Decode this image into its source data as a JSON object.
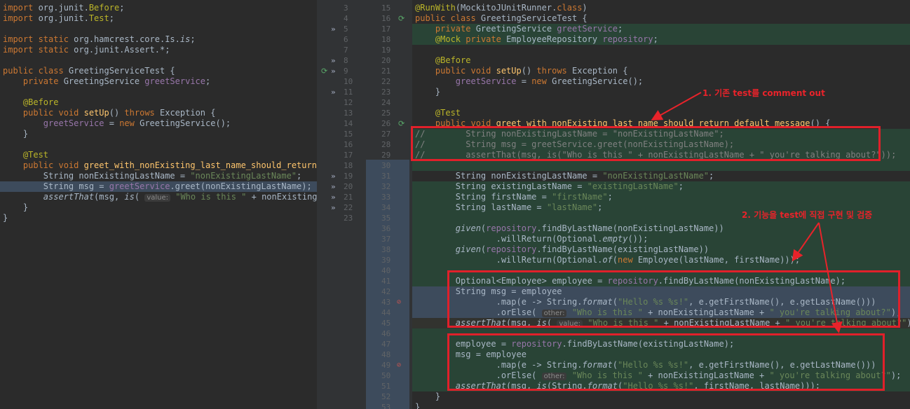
{
  "left": {
    "lines": [
      {
        "segs": [
          {
            "c": "kw",
            "t": "import "
          },
          {
            "t": "org.junit."
          },
          {
            "c": "ann",
            "t": "Before"
          },
          {
            "t": ";"
          }
        ]
      },
      {
        "segs": [
          {
            "c": "kw",
            "t": "import "
          },
          {
            "t": "org.junit."
          },
          {
            "c": "ann",
            "t": "Test"
          },
          {
            "t": ";"
          }
        ]
      },
      {
        "segs": []
      },
      {
        "segs": [
          {
            "c": "kw",
            "t": "import static "
          },
          {
            "t": "org.hamcrest.core.Is."
          },
          {
            "c": "it",
            "t": "is"
          },
          {
            "t": ";"
          }
        ]
      },
      {
        "segs": [
          {
            "c": "kw",
            "t": "import static "
          },
          {
            "t": "org.junit.Assert.*;"
          }
        ]
      },
      {
        "segs": []
      },
      {
        "segs": [
          {
            "c": "kw",
            "t": "public class "
          },
          {
            "t": "GreetingServiceTest {"
          }
        ]
      },
      {
        "segs": [
          {
            "t": "    "
          },
          {
            "c": "kw",
            "t": "private "
          },
          {
            "t": "GreetingService "
          },
          {
            "c": "fld",
            "t": "greetService"
          },
          {
            "t": ";"
          }
        ]
      },
      {
        "segs": []
      },
      {
        "segs": [
          {
            "t": "    "
          },
          {
            "c": "ann",
            "t": "@Before"
          }
        ]
      },
      {
        "segs": [
          {
            "t": "    "
          },
          {
            "c": "kw",
            "t": "public void "
          },
          {
            "c": "fn",
            "t": "setUp"
          },
          {
            "t": "() "
          },
          {
            "c": "kw",
            "t": "throws "
          },
          {
            "t": "Exception {"
          }
        ]
      },
      {
        "segs": [
          {
            "t": "        "
          },
          {
            "c": "fld",
            "t": "greetService"
          },
          {
            "t": " = "
          },
          {
            "c": "kw",
            "t": "new "
          },
          {
            "t": "GreetingService();"
          }
        ]
      },
      {
        "segs": [
          {
            "t": "    }"
          }
        ]
      },
      {
        "segs": []
      },
      {
        "segs": [
          {
            "t": "    "
          },
          {
            "c": "ann",
            "t": "@Test"
          }
        ]
      },
      {
        "segs": [
          {
            "t": "    "
          },
          {
            "c": "kw",
            "t": "public void "
          },
          {
            "c": "fn",
            "t": "greet_with_nonExisting_last_name_should_return_d"
          }
        ]
      },
      {
        "segs": [
          {
            "t": "        String nonExistingLastName = "
          },
          {
            "c": "str",
            "t": "\"nonExistingLastName\""
          },
          {
            "t": ";"
          }
        ]
      },
      {
        "hl": "blue",
        "segs": [
          {
            "t": "        String msg = "
          },
          {
            "c": "fld",
            "t": "greetService"
          },
          {
            "t": ".greet(nonExistingLastName);"
          }
        ]
      },
      {
        "segs": [
          {
            "t": "        "
          },
          {
            "c": "it",
            "t": "assertThat"
          },
          {
            "t": "(msg, "
          },
          {
            "c": "it",
            "t": "is"
          },
          {
            "t": "( "
          },
          {
            "c": "hint",
            "t": "value:"
          },
          {
            "t": " "
          },
          {
            "c": "str",
            "t": "\"Who is this \""
          },
          {
            "t": " + nonExistingLas"
          }
        ]
      },
      {
        "segs": [
          {
            "t": "    }"
          }
        ]
      },
      {
        "segs": [
          {
            "t": "}"
          }
        ]
      }
    ]
  },
  "left_gutter": [
    {
      "n": "3"
    },
    {
      "n": "4"
    },
    {
      "n": "5",
      "m": "»"
    },
    {
      "n": "6"
    },
    {
      "n": "7"
    },
    {
      "n": "8",
      "m": "»"
    },
    {
      "n": "9",
      "m": "»",
      "run": true
    },
    {
      "n": "10"
    },
    {
      "n": "11",
      "m": "»"
    },
    {
      "n": "12"
    },
    {
      "n": "13"
    },
    {
      "n": "14"
    },
    {
      "n": "15"
    },
    {
      "n": "16"
    },
    {
      "n": "17"
    },
    {
      "n": "18"
    },
    {
      "n": "19",
      "m": "»"
    },
    {
      "n": "20",
      "m": "»"
    },
    {
      "n": "21",
      "m": "»"
    },
    {
      "n": "22",
      "m": "»"
    },
    {
      "n": "23"
    }
  ],
  "right_gutter": [
    {
      "n": "15"
    },
    {
      "n": "16",
      "run": true
    },
    {
      "n": "17"
    },
    {
      "n": "18"
    },
    {
      "n": "19"
    },
    {
      "n": "20"
    },
    {
      "n": "21"
    },
    {
      "n": "22"
    },
    {
      "n": "23"
    },
    {
      "n": "24"
    },
    {
      "n": "25"
    },
    {
      "n": "26",
      "run": true
    },
    {
      "n": "27"
    },
    {
      "n": "28"
    },
    {
      "n": "29"
    },
    {
      "n": "30"
    },
    {
      "n": "31"
    },
    {
      "n": "32"
    },
    {
      "n": "33"
    },
    {
      "n": "34"
    },
    {
      "n": "35"
    },
    {
      "n": "36"
    },
    {
      "n": "37"
    },
    {
      "n": "38"
    },
    {
      "n": "39"
    },
    {
      "n": "40"
    },
    {
      "n": "41"
    },
    {
      "n": "42"
    },
    {
      "n": "43",
      "err": true
    },
    {
      "n": "44"
    },
    {
      "n": "45"
    },
    {
      "n": "46"
    },
    {
      "n": "47"
    },
    {
      "n": "48"
    },
    {
      "n": "49",
      "err": true
    },
    {
      "n": "50"
    },
    {
      "n": "51"
    },
    {
      "n": "52"
    },
    {
      "n": "53"
    }
  ],
  "right": {
    "lines": [
      {
        "segs": [
          {
            "c": "ann",
            "t": "@RunWith"
          },
          {
            "t": "(MockitoJUnitRunner."
          },
          {
            "c": "kw",
            "t": "class"
          },
          {
            "t": ")"
          }
        ]
      },
      {
        "segs": [
          {
            "c": "kw",
            "t": "public class "
          },
          {
            "t": "GreetingServiceTest {"
          }
        ]
      },
      {
        "hl": "green",
        "segs": [
          {
            "t": "    "
          },
          {
            "c": "kw",
            "t": "private "
          },
          {
            "t": "GreetingService "
          },
          {
            "c": "fld",
            "t": "greetService"
          },
          {
            "t": ";"
          }
        ]
      },
      {
        "hl": "green",
        "segs": [
          {
            "t": "    "
          },
          {
            "c": "ann",
            "t": "@Mock "
          },
          {
            "c": "kw",
            "t": "private "
          },
          {
            "t": "EmployeeRepository "
          },
          {
            "c": "fld",
            "t": "repository"
          },
          {
            "t": ";"
          }
        ]
      },
      {
        "segs": []
      },
      {
        "segs": [
          {
            "t": "    "
          },
          {
            "c": "ann",
            "t": "@Before"
          }
        ]
      },
      {
        "segs": [
          {
            "t": "    "
          },
          {
            "c": "kw",
            "t": "public void "
          },
          {
            "c": "fn",
            "t": "setUp"
          },
          {
            "t": "() "
          },
          {
            "c": "kw",
            "t": "throws "
          },
          {
            "t": "Exception {"
          }
        ]
      },
      {
        "segs": [
          {
            "t": "        "
          },
          {
            "c": "fld",
            "t": "greetService"
          },
          {
            "t": " = "
          },
          {
            "c": "kw",
            "t": "new "
          },
          {
            "t": "GreetingService();"
          }
        ]
      },
      {
        "segs": [
          {
            "t": "    }"
          }
        ]
      },
      {
        "segs": []
      },
      {
        "segs": [
          {
            "t": "    "
          },
          {
            "c": "ann",
            "t": "@Test"
          }
        ]
      },
      {
        "segs": [
          {
            "t": "    "
          },
          {
            "c": "kw",
            "t": "public void "
          },
          {
            "c": "fn",
            "t": "greet_with_nonExisting_last_name_should_return_default_message"
          },
          {
            "t": "() {"
          }
        ]
      },
      {
        "hl": "green",
        "segs": [
          {
            "c": "cm",
            "t": "//        String nonExistingLastName = \"nonExistingLastName\";"
          }
        ]
      },
      {
        "hl": "green",
        "segs": [
          {
            "c": "cm",
            "t": "//        String msg = greetService.greet(nonExistingLastName);"
          }
        ]
      },
      {
        "hl": "green",
        "segs": [
          {
            "c": "cm",
            "t": "//        assertThat(msg, is(\"Who is this \" + nonExistingLastName + \" you're talking about?\"));"
          }
        ]
      },
      {
        "hl": "green",
        "segs": []
      },
      {
        "segs": [
          {
            "t": "        String nonExistingLastName = "
          },
          {
            "c": "str",
            "t": "\"nonExistingLastName\""
          },
          {
            "t": ";"
          }
        ]
      },
      {
        "hl": "green",
        "segs": [
          {
            "t": "        String existingLastName = "
          },
          {
            "c": "str",
            "t": "\"existingLastName\""
          },
          {
            "t": ";"
          }
        ]
      },
      {
        "hl": "green",
        "segs": [
          {
            "t": "        String firstName = "
          },
          {
            "c": "str",
            "t": "\"firstName\""
          },
          {
            "t": ";"
          }
        ]
      },
      {
        "hl": "green",
        "segs": [
          {
            "t": "        String lastName = "
          },
          {
            "c": "str",
            "t": "\"lastName\""
          },
          {
            "t": ";"
          }
        ]
      },
      {
        "hl": "green",
        "segs": []
      },
      {
        "hl": "green",
        "segs": [
          {
            "t": "        "
          },
          {
            "c": "it",
            "t": "given"
          },
          {
            "t": "("
          },
          {
            "c": "fld",
            "t": "repository"
          },
          {
            "t": ".findByLastName(nonExistingLastName))"
          }
        ]
      },
      {
        "hl": "green",
        "segs": [
          {
            "t": "                .willReturn(Optional."
          },
          {
            "c": "it",
            "t": "empty"
          },
          {
            "t": "());"
          }
        ]
      },
      {
        "hl": "green",
        "segs": [
          {
            "t": "        "
          },
          {
            "c": "it",
            "t": "given"
          },
          {
            "t": "("
          },
          {
            "c": "fld",
            "t": "repository"
          },
          {
            "t": ".findByLastName(existingLastName))"
          }
        ]
      },
      {
        "hl": "green",
        "segs": [
          {
            "t": "                .willReturn(Optional."
          },
          {
            "c": "it",
            "t": "of"
          },
          {
            "t": "("
          },
          {
            "c": "kw",
            "t": "new "
          },
          {
            "t": "Employee(lastName, firstName)));"
          }
        ]
      },
      {
        "hl": "green",
        "segs": []
      },
      {
        "hl": "green",
        "segs": [
          {
            "t": "        Optional<Employee> employee = "
          },
          {
            "c": "fld",
            "t": "repository"
          },
          {
            "t": ".findByLastName(nonExistingLastName);"
          }
        ]
      },
      {
        "hl": "blue",
        "segs": [
          {
            "t": "        String msg = employee"
          }
        ]
      },
      {
        "hl": "blue",
        "segs": [
          {
            "t": "                .map(e -> String."
          },
          {
            "c": "it",
            "t": "format"
          },
          {
            "t": "("
          },
          {
            "c": "str",
            "t": "\"Hello %s %s!\""
          },
          {
            "t": ", e.getFirstName(), e.getLastName()))"
          }
        ]
      },
      {
        "hl": "blue",
        "segs": [
          {
            "t": "                .orElse( "
          },
          {
            "c": "hint",
            "t": "other:"
          },
          {
            "t": " "
          },
          {
            "c": "str",
            "t": "\"Who is this \""
          },
          {
            "t": " + nonExistingLastName + "
          },
          {
            "c": "str",
            "t": "\" you're talking about?\""
          },
          {
            "t": ");"
          }
        ]
      },
      {
        "hl": "cur",
        "segs": [
          {
            "t": "        "
          },
          {
            "c": "it",
            "t": "assertThat"
          },
          {
            "t": "(msg, "
          },
          {
            "c": "it",
            "t": "is"
          },
          {
            "t": "( "
          },
          {
            "c": "hint",
            "t": "value:"
          },
          {
            "t": " "
          },
          {
            "c": "str",
            "t": "\"Who is this \""
          },
          {
            "t": " + nonExistingLastName + "
          },
          {
            "c": "str",
            "t": "\" you're talking about?\""
          },
          {
            "t": "));"
          }
        ]
      },
      {
        "hl": "green",
        "segs": []
      },
      {
        "hl": "green",
        "segs": [
          {
            "t": "        employee = "
          },
          {
            "c": "fld",
            "t": "repository"
          },
          {
            "t": ".findByLastName(existingLastName);"
          }
        ]
      },
      {
        "hl": "green",
        "segs": [
          {
            "t": "        msg = employee"
          }
        ]
      },
      {
        "hl": "green",
        "segs": [
          {
            "t": "                .map(e -> String."
          },
          {
            "c": "it",
            "t": "format"
          },
          {
            "t": "("
          },
          {
            "c": "str",
            "t": "\"Hello %s %s!\""
          },
          {
            "t": ", e.getFirstName(), e.getLastName()))"
          }
        ]
      },
      {
        "hl": "green",
        "segs": [
          {
            "t": "                .orElse( "
          },
          {
            "c": "hint",
            "t": "other:"
          },
          {
            "t": " "
          },
          {
            "c": "str",
            "t": "\"Who is this \""
          },
          {
            "t": " + nonExistingLastName + "
          },
          {
            "c": "str",
            "t": "\" you're talking about?\""
          },
          {
            "t": ");"
          }
        ]
      },
      {
        "hl": "green",
        "segs": [
          {
            "t": "        "
          },
          {
            "c": "it",
            "t": "assertThat"
          },
          {
            "t": "(msg, "
          },
          {
            "c": "it",
            "t": "is"
          },
          {
            "t": "(String."
          },
          {
            "c": "it",
            "t": "format"
          },
          {
            "t": "("
          },
          {
            "c": "str",
            "t": "\"Hello %s %s!\""
          },
          {
            "t": ", firstName, lastName)));"
          }
        ]
      },
      {
        "segs": [
          {
            "t": "    }"
          }
        ]
      },
      {
        "segs": [
          {
            "t": "}"
          }
        ]
      }
    ]
  },
  "annotations": {
    "callout1": "1. 기존 test를 comment out",
    "callout2": "2. 기능을 test에 직접 구현 및 검증"
  },
  "colors": {
    "highlight_box": "#e0202a",
    "callout_text": "#e8232a"
  }
}
